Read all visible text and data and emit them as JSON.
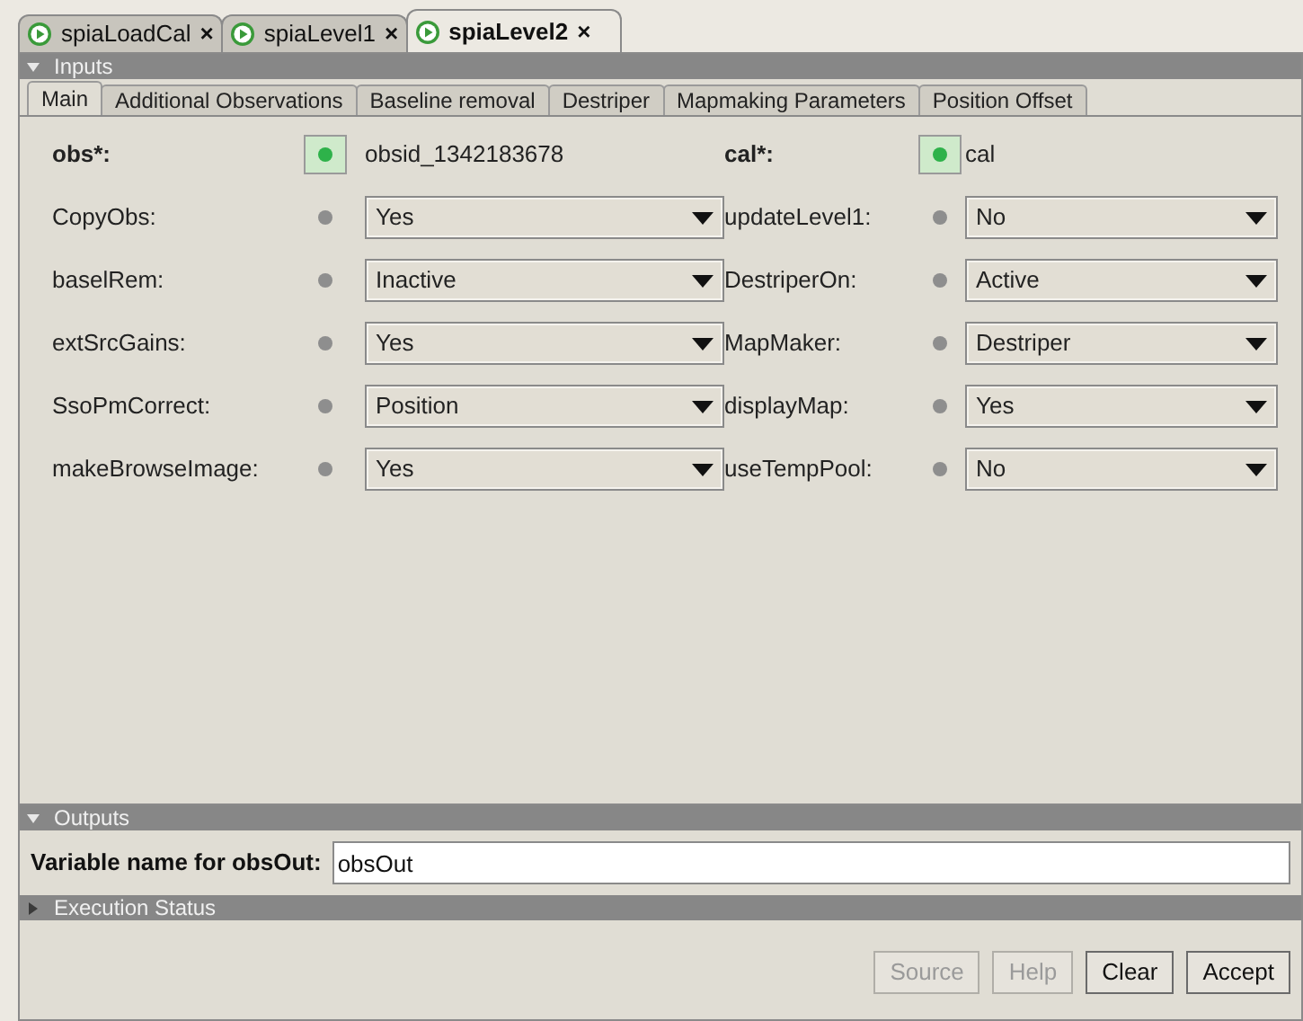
{
  "doc_tabs": [
    {
      "label": "spiaLoadCal",
      "close": "×",
      "selected": false
    },
    {
      "label": "spiaLevel1",
      "close": "×",
      "selected": false
    },
    {
      "label": "spiaLevel2",
      "close": "×",
      "selected": true
    }
  ],
  "inputs": {
    "title": "Inputs",
    "expanded": true,
    "tabs": [
      {
        "label": "Main",
        "selected": true
      },
      {
        "label": "Additional Observations",
        "selected": false
      },
      {
        "label": "Baseline removal",
        "selected": false
      },
      {
        "label": "Destriper",
        "selected": false
      },
      {
        "label": "Mapmaking Parameters",
        "selected": false
      },
      {
        "label": "Position Offset",
        "selected": false
      }
    ],
    "rows": [
      [
        {
          "label": "obs*:",
          "kind": "text",
          "value": "obsid_1342183678"
        },
        {
          "label": "cal*:",
          "kind": "text",
          "value": "cal"
        }
      ],
      [
        {
          "label": "CopyObs:",
          "kind": "select",
          "value": "Yes"
        },
        {
          "label": "updateLevel1:",
          "kind": "select",
          "value": "No"
        }
      ],
      [
        {
          "label": "baselRem:",
          "kind": "select",
          "value": "Inactive"
        },
        {
          "label": "DestriperOn:",
          "kind": "select",
          "value": "Active"
        }
      ],
      [
        {
          "label": "extSrcGains:",
          "kind": "select",
          "value": "Yes"
        },
        {
          "label": "MapMaker:",
          "kind": "select",
          "value": "Destriper"
        }
      ],
      [
        {
          "label": "SsoPmCorrect:",
          "kind": "select",
          "value": "Position"
        },
        {
          "label": "displayMap:",
          "kind": "select",
          "value": "Yes"
        }
      ],
      [
        {
          "label": "makeBrowseImage:",
          "kind": "select",
          "value": "Yes"
        },
        {
          "label": "useTempPool:",
          "kind": "select",
          "value": "No"
        }
      ]
    ]
  },
  "outputs": {
    "title": "Outputs",
    "expanded": true,
    "label": "Variable name for obsOut:",
    "value": "obsOut"
  },
  "execution_status": {
    "title": "Execution Status",
    "expanded": false
  },
  "buttons": [
    {
      "label": "Source",
      "disabled": true
    },
    {
      "label": "Help",
      "disabled": true
    },
    {
      "label": "Clear",
      "disabled": false
    },
    {
      "label": "Accept",
      "disabled": false
    }
  ]
}
